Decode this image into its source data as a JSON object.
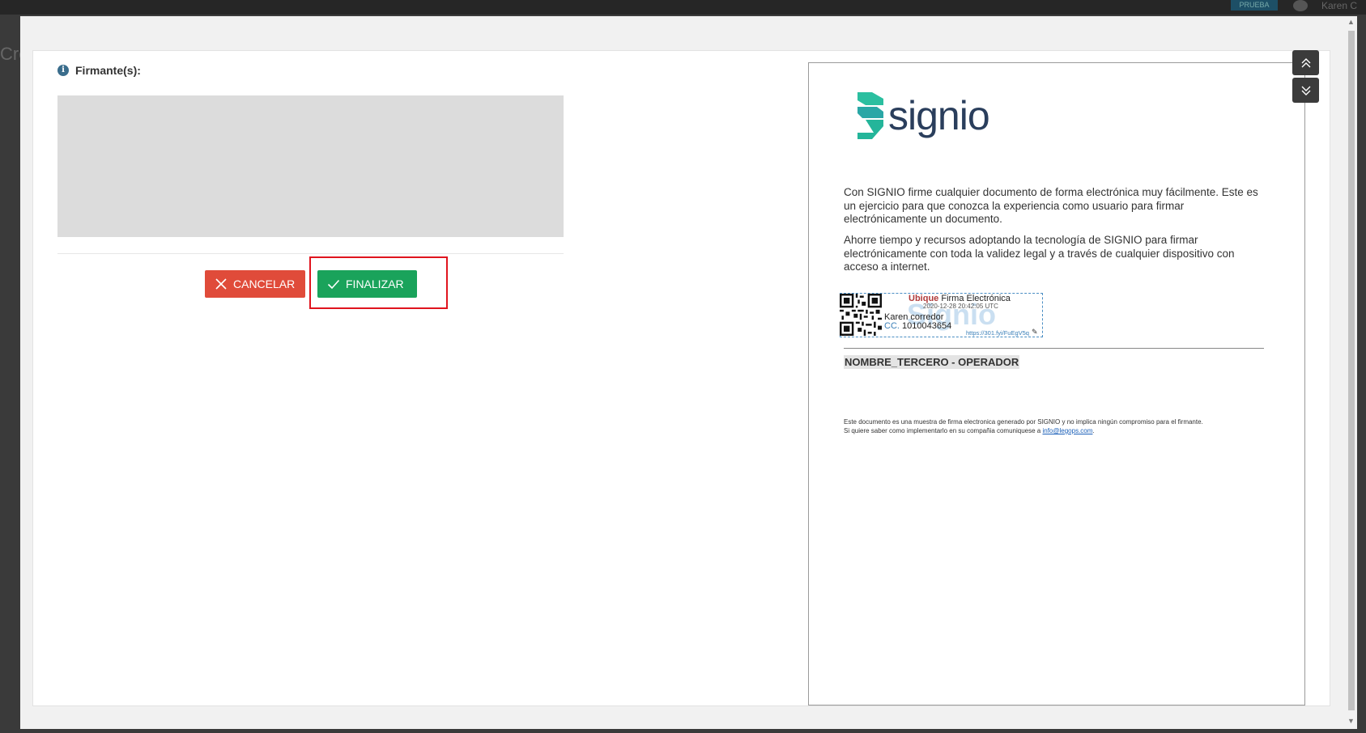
{
  "background": {
    "badge": "PRUEBA",
    "user_name": "Karen C",
    "page_title": "Cre"
  },
  "signers": {
    "label": "Firmante(s):"
  },
  "actions": {
    "cancel_label": "CANCELAR",
    "finish_label": "FINALIZAR"
  },
  "document": {
    "logo_text": "signio",
    "paragraph_1": "Con SIGNIO firme cualquier documento de forma electrónica muy fácilmente. Este es un ejercicio para que conozca la experiencia como usuario para firmar electrónicamente un documento.",
    "paragraph_2": "Ahorre tiempo y recursos adoptando la tecnología de SIGNIO para firmar electrónicamente con toda la validez legal y a través de cualquier dispositivo con acceso a internet.",
    "stamp": {
      "ubique": "Ubique",
      "title": "Firma Electrónica",
      "date": "2020-12-28 20:42:05 UTC",
      "watermark": "Signio",
      "name": "Karen corredor",
      "cc_prefix": "CC.",
      "cc_number": "1010043654",
      "url": "https://301.fyi/FuEgV5q"
    },
    "operator": "NOMBRE_TERCERO - OPERADOR",
    "footer_line1": "Este documento es una muestra de firma electronica generado por SIGNIO y no implica ningún compromiso para el firmante.",
    "footer_line2_prefix": "Si quiere saber como implementarlo en su compañia comuniquese a",
    "footer_email": "info@legops.com",
    "footer_line2_suffix": "."
  },
  "colors": {
    "cancel": "#e04b3a",
    "finish": "#1aa35b",
    "highlight": "#e0141e",
    "logo_teal": "#2bbfa0",
    "logo_navy": "#2a3e5c"
  },
  "icons": {
    "info": "info-icon",
    "cancel": "close-icon",
    "finish": "check-icon",
    "nav_up": "double-chevron-up-icon",
    "nav_down": "double-chevron-down-icon"
  }
}
